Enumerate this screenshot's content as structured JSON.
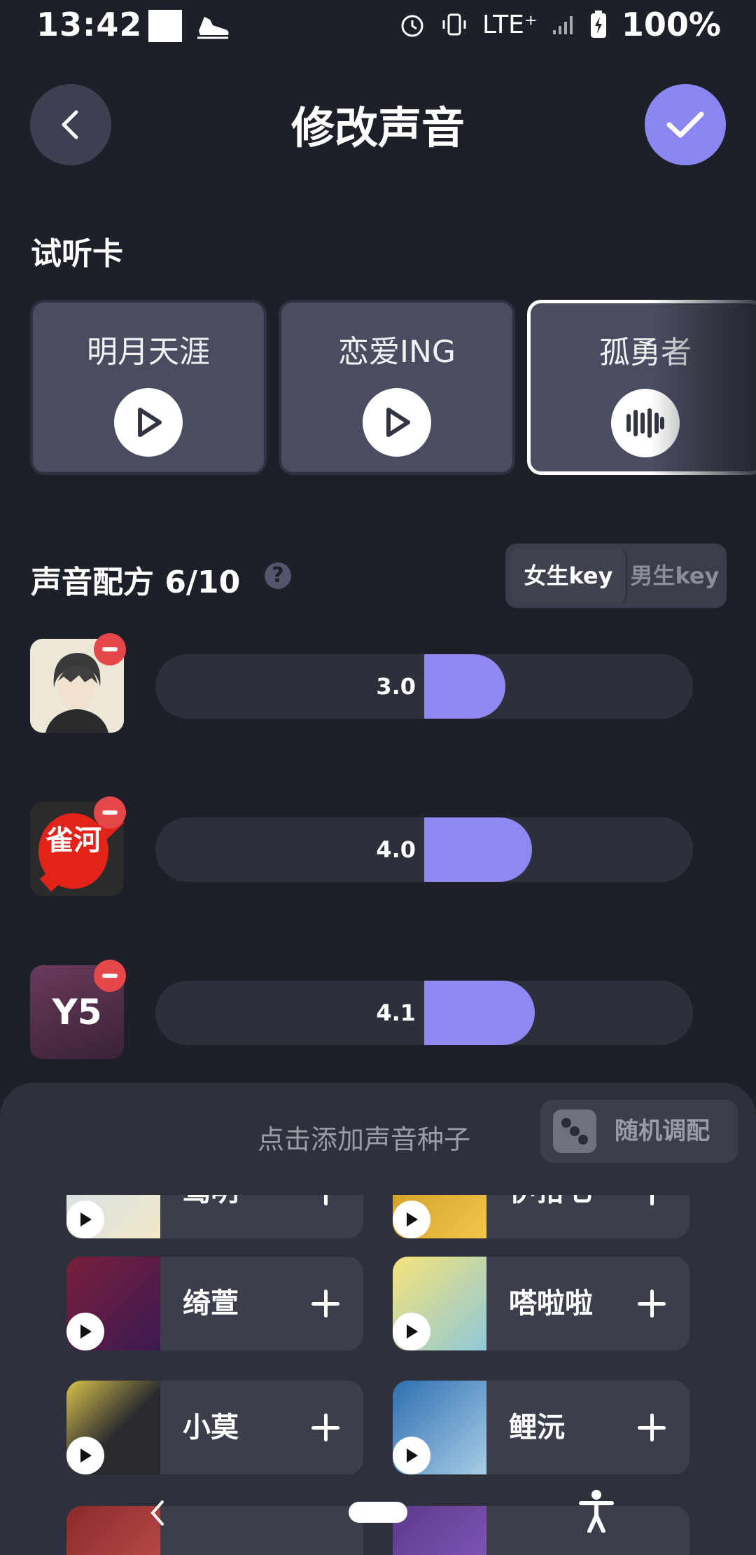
{
  "status_bar": {
    "time": "13:42",
    "network": "LTE⁺",
    "battery": "100%"
  },
  "header": {
    "title": "修改声音",
    "back_icon": "chevron-left-icon",
    "confirm_icon": "check-icon"
  },
  "trial": {
    "label": "试听卡",
    "cards": [
      {
        "label": "明月天涯",
        "state": "play"
      },
      {
        "label": "恋爱ING",
        "state": "play"
      },
      {
        "label": "孤勇者",
        "state": "playing",
        "selected": true
      }
    ]
  },
  "recipe": {
    "title": "声音配方 6/10",
    "help": "?",
    "key_options": [
      "女生key",
      "男生key"
    ],
    "selected_key": "女生key",
    "rows": [
      {
        "value": "3.0",
        "level": 3.0,
        "avatar_text": ""
      },
      {
        "value": "4.0",
        "level": 4.0,
        "avatar_text": "雀河"
      },
      {
        "value": "4.1",
        "level": 4.1,
        "avatar_text": "Y5"
      }
    ]
  },
  "panel": {
    "hint": "点击添加声音种子",
    "random_label": "随机调配",
    "seeds": [
      {
        "name": "鸾明"
      },
      {
        "name": "伊拾七"
      },
      {
        "name": "绮萱"
      },
      {
        "name": "嗒啦啦"
      },
      {
        "name": "小莫"
      },
      {
        "name": "鲤沅"
      }
    ]
  },
  "colors": {
    "background": "#1d2028",
    "accent": "#8e88f0",
    "remove": "#e5474b",
    "panel": "#2e313b"
  }
}
